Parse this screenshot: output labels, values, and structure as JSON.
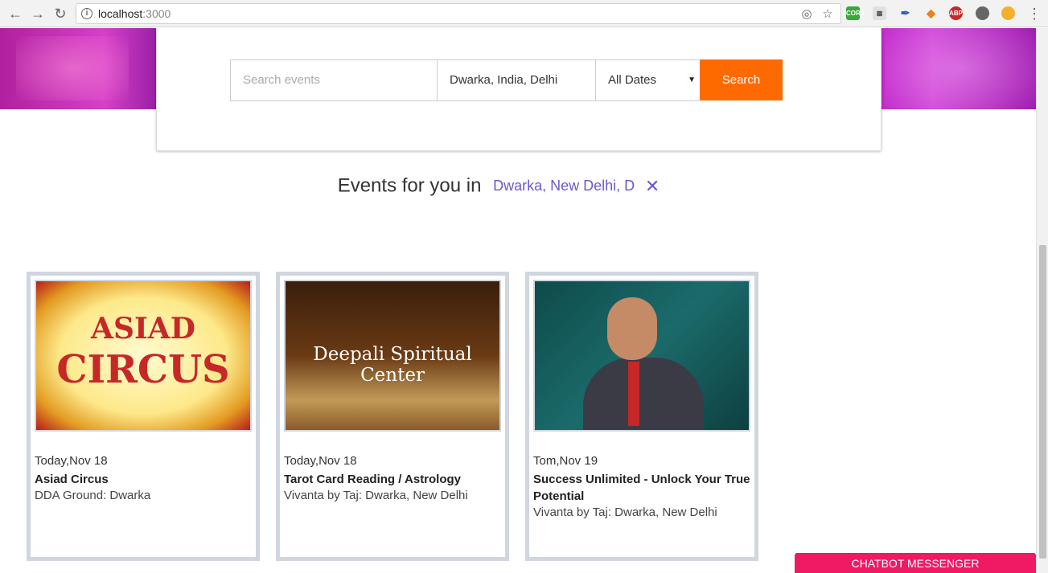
{
  "browser": {
    "url_host": "localhost",
    "url_port": ":3000",
    "extensions": [
      "CORS",
      "ABP"
    ]
  },
  "search": {
    "placeholder": "Search events",
    "location_value": "Dwarka, India, Delhi",
    "date_selected": "All Dates",
    "button_label": "Search"
  },
  "heading": {
    "text": "Events for you in",
    "location": "Dwarka, New Delhi, D",
    "close": "✕"
  },
  "events": [
    {
      "date": "Today,Nov 18",
      "title": "Asiad Circus",
      "venue": "DDA Ground: Dwarka",
      "image_text_1": "ASIAD",
      "image_text_2": "CIRCUS"
    },
    {
      "date": "Today,Nov 18",
      "title": "Tarot Card Reading / Astrology",
      "venue": "Vivanta by Taj: Dwarka, New Delhi",
      "image_text": "Deepali Spiritual Center"
    },
    {
      "date": "Tom,Nov 19",
      "title": "Success Unlimited - Unlock Your True Potential",
      "venue": "Vivanta by Taj: Dwarka, New Delhi"
    }
  ],
  "chatbot": {
    "label": "CHATBOT MESSENGER"
  },
  "colors": {
    "accent": "#ff6a00",
    "link": "#6a5acd",
    "chatbot": "#ef1a63"
  }
}
